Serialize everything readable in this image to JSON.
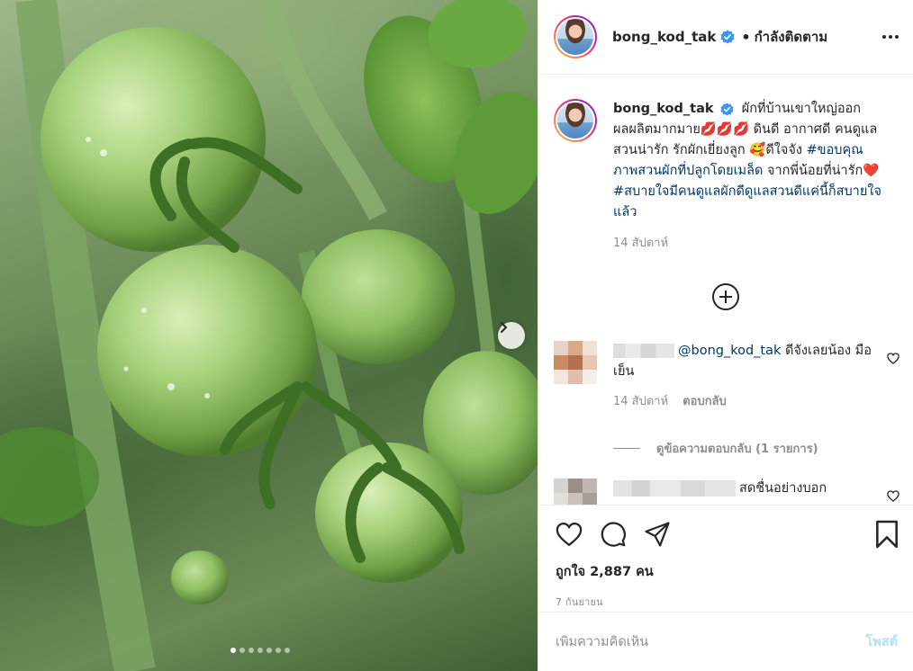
{
  "post": {
    "username": "bong_kod_tak",
    "follow_status": "กำลังติดตาม",
    "separator": "•"
  },
  "caption": {
    "username": "bong_kod_tak",
    "text_part1": "ผักที่บ้านเขาใหญ่ออกผลผลิตมากมาย💋💋💋 ดินดี อากาศดี คนดูแลสวนน่ารัก รักผักเยี่ยงลูก 🥰ดีใจจัง",
    "hashtag1": "#ขอบคุณภาพสวนผักที่ปลูกโดยเมล็ด",
    "text_part2": " จากพี่น้อยที่น่ารัก❤️",
    "hashtag2": "#สบายใจมีคนดูแลผักดีดูแลสวนดีแค่นี้ก็สบายใจแล้ว",
    "timestamp": "14 สัปดาห์"
  },
  "comments": [
    {
      "mention": "@bong_kod_tak",
      "text": " ดีจังเลยน้อง มือเย็น",
      "timestamp": "14 สัปดาห์",
      "reply_label": "ตอบกลับ",
      "view_replies": "ดูข้อความตอบกลับ (1 รายการ)",
      "avatar_colors": [
        "#e8d2c4",
        "#d9a98a",
        "#f0e0d6",
        "#c98a66",
        "#b5704f",
        "#e6c7b3",
        "#f1e6de",
        "#dcbfae",
        "#f5eee9"
      ]
    },
    {
      "text": "สดชื่นอย่างบอก",
      "avatar_colors": [
        "#d6d2cf",
        "#9a8f88",
        "#bfb7b1",
        "#e2ded9",
        "#c9c1bb",
        "#a79e97",
        "#eeece9",
        "#d8d3ce",
        "#c5beb8"
      ]
    }
  ],
  "likes": "ถูกใจ 2,887 คน",
  "date": "7 กันยายน",
  "add_comment": {
    "placeholder": "เพิ่มความคิดเห็น",
    "post_label": "โพสต์"
  },
  "carousel": {
    "count": 7,
    "active_index": 0
  },
  "icons": {
    "verified": "verified-badge-icon",
    "more": "more-options-icon",
    "like": "heart-icon",
    "comment": "comment-icon",
    "share": "share-icon",
    "save": "bookmark-icon",
    "next": "chevron-right-icon",
    "load_more": "plus-circle-icon"
  },
  "colors": {
    "link": "#00376b",
    "verified": "#3897f0",
    "post_disabled": "#b2dffc",
    "muted": "#8e8e8e"
  }
}
